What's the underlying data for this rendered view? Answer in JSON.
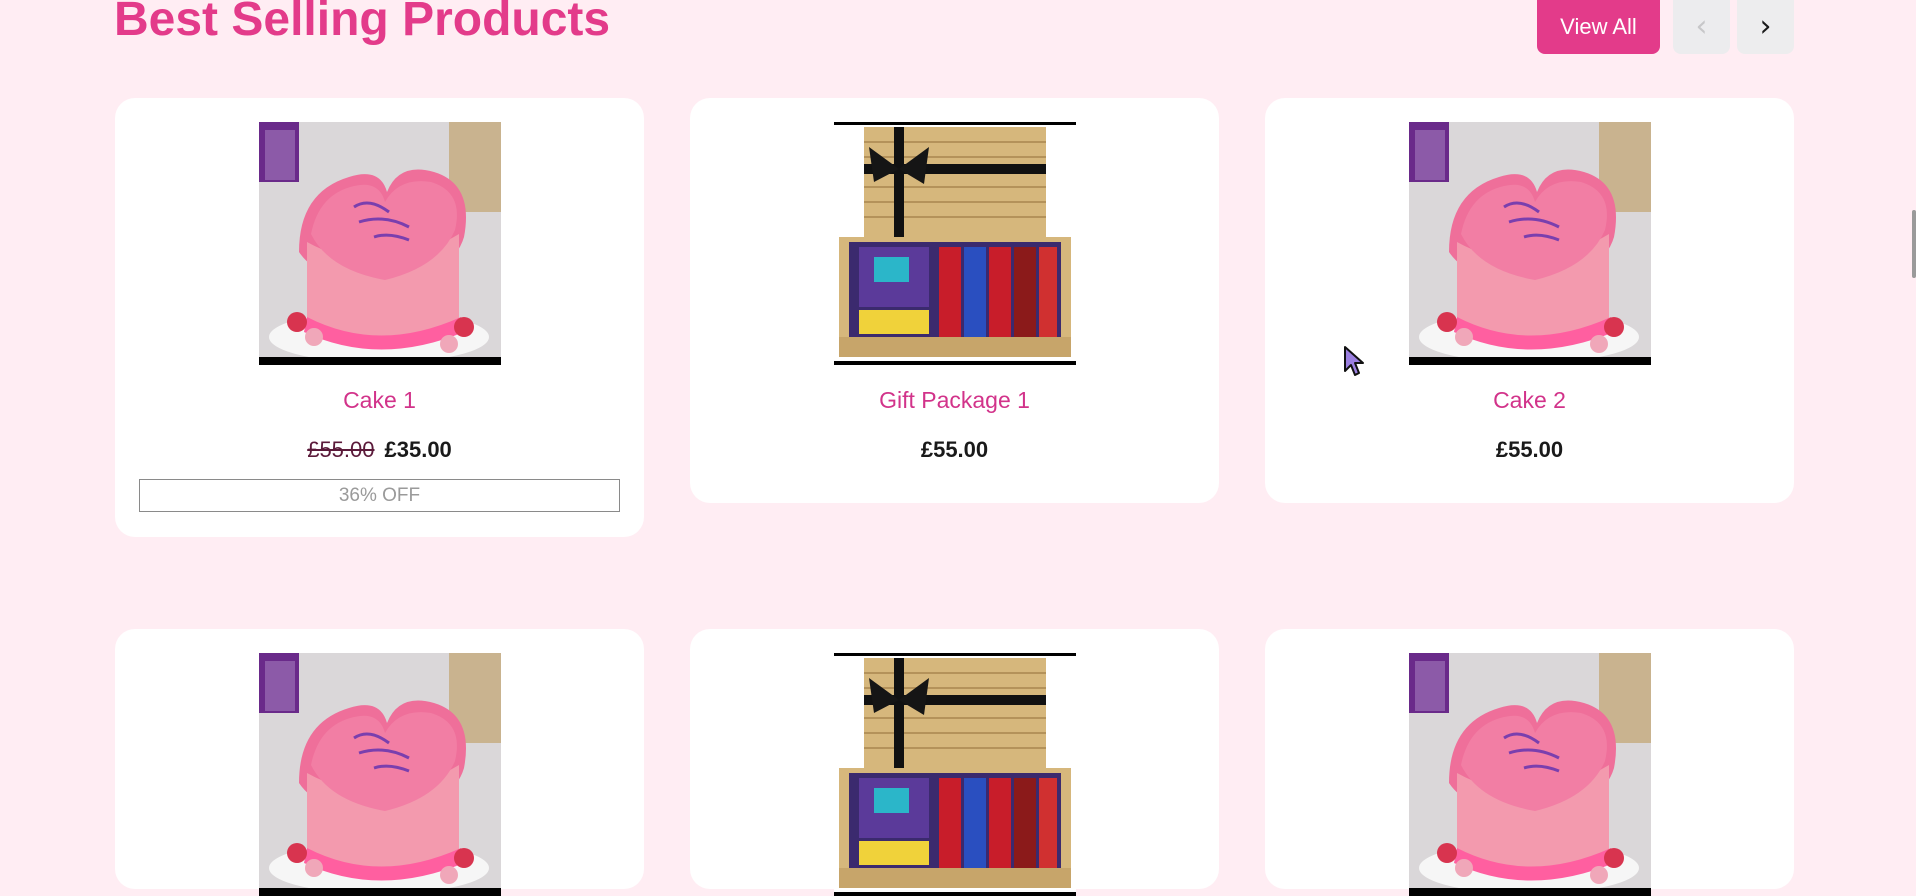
{
  "section": {
    "title": "Best Selling Products",
    "view_all_label": "View All",
    "prev_icon": "‹",
    "next_icon": "›"
  },
  "products": [
    {
      "name": "Cake 1",
      "old_price": "£55.00",
      "price": "£35.00",
      "discount": "36% OFF",
      "image": "heart-cake-image"
    },
    {
      "name": "Gift Package 1",
      "old_price": null,
      "price": "£55.00",
      "discount": null,
      "image": "gift-hamper-image"
    },
    {
      "name": "Cake 2",
      "old_price": null,
      "price": "£55.00",
      "discount": null,
      "image": "heart-cake-image"
    },
    {
      "image": "heart-cake-image"
    },
    {
      "image": "gift-hamper-image"
    },
    {
      "image": "heart-cake-image"
    }
  ],
  "colors": {
    "accent": "#e33b8a",
    "product_name": "#d2338a",
    "page_background": "#ffedf3",
    "card_background": "#ffffff"
  },
  "icons": {
    "prev": "chevron-left-icon",
    "next": "chevron-right-icon",
    "cursor": "mouse-pointer-icon"
  }
}
